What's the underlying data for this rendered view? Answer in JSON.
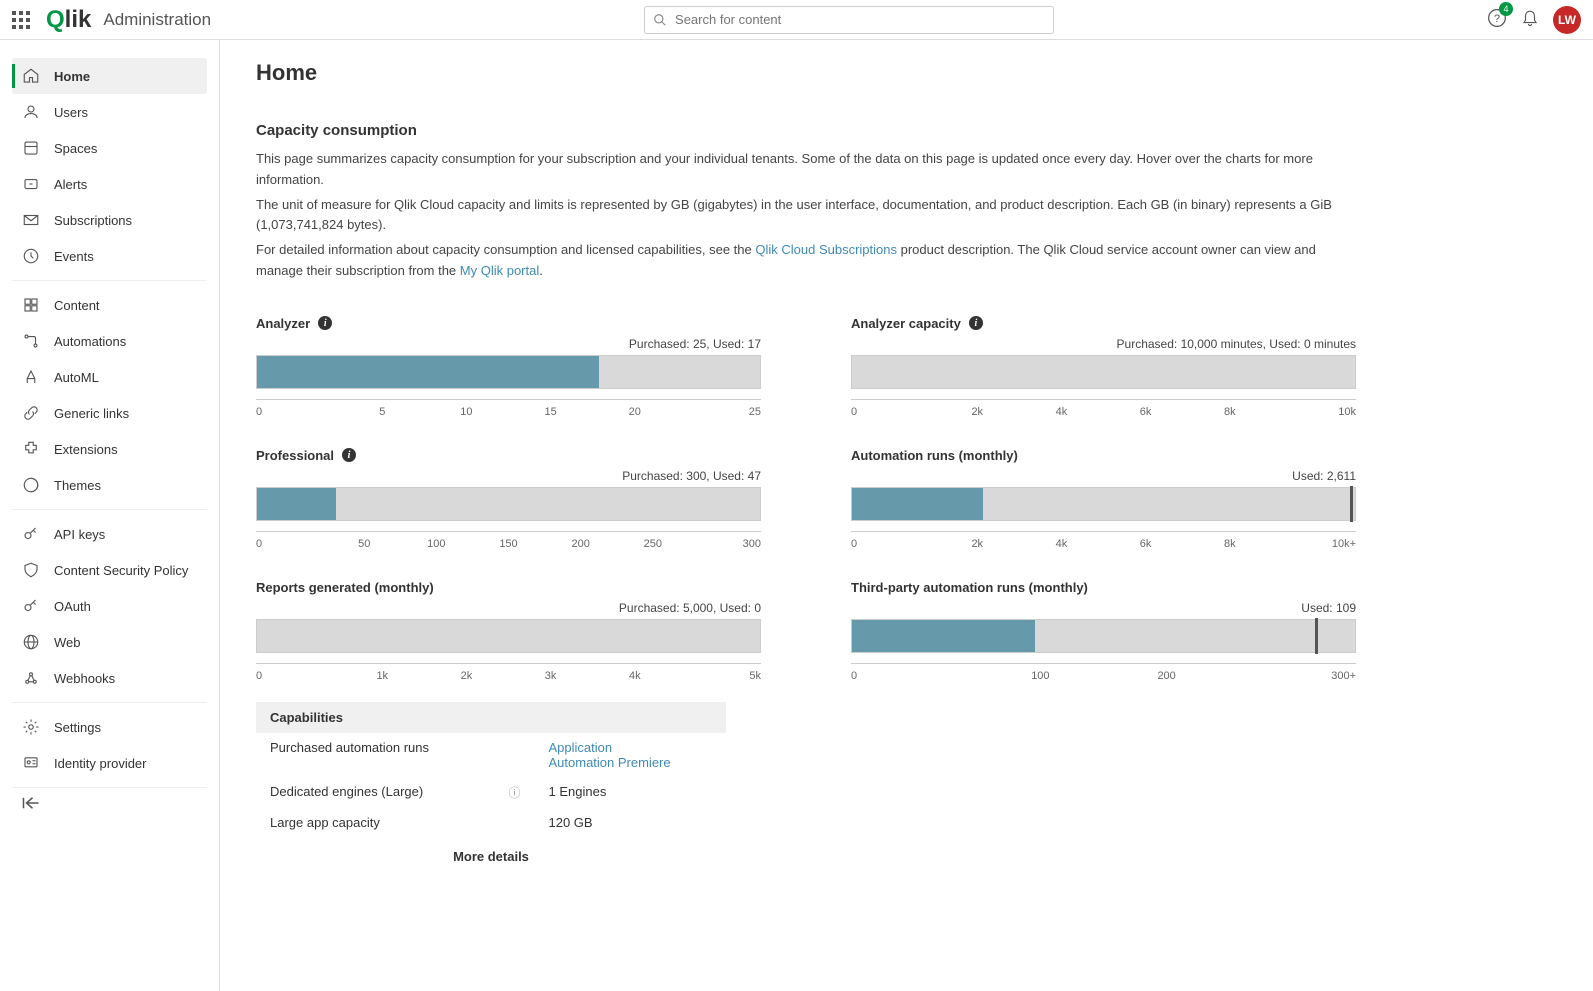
{
  "header": {
    "app_title": "Administration",
    "search_placeholder": "Search for content",
    "help_badge": "4",
    "avatar_initials": "LW"
  },
  "sidebar": {
    "groups": [
      {
        "items": [
          {
            "key": "home",
            "label": "Home",
            "active": true
          },
          {
            "key": "users",
            "label": "Users"
          },
          {
            "key": "spaces",
            "label": "Spaces"
          },
          {
            "key": "alerts",
            "label": "Alerts"
          },
          {
            "key": "subscriptions",
            "label": "Subscriptions"
          },
          {
            "key": "events",
            "label": "Events"
          }
        ]
      },
      {
        "items": [
          {
            "key": "content",
            "label": "Content"
          },
          {
            "key": "automations",
            "label": "Automations"
          },
          {
            "key": "automl",
            "label": "AutoML"
          },
          {
            "key": "generic-links",
            "label": "Generic links"
          },
          {
            "key": "extensions",
            "label": "Extensions"
          },
          {
            "key": "themes",
            "label": "Themes"
          }
        ]
      },
      {
        "items": [
          {
            "key": "api-keys",
            "label": "API keys"
          },
          {
            "key": "csp",
            "label": "Content Security Policy"
          },
          {
            "key": "oauth",
            "label": "OAuth"
          },
          {
            "key": "web",
            "label": "Web"
          },
          {
            "key": "webhooks",
            "label": "Webhooks"
          }
        ]
      },
      {
        "items": [
          {
            "key": "settings",
            "label": "Settings"
          },
          {
            "key": "identity-provider",
            "label": "Identity provider"
          }
        ]
      }
    ]
  },
  "page": {
    "title": "Home",
    "section_title": "Capacity consumption",
    "intro_p1": "This page summarizes capacity consumption for your subscription and your individual tenants. Some of the data on this page is updated once every day. Hover over the charts for more information.",
    "intro_p2": "The unit of measure for Qlik Cloud capacity and limits is represented by GB (gigabytes) in the user interface, documentation, and product description. Each GB (in binary) represents a GiB (1,073,741,824 bytes).",
    "intro_p3_pre": "For detailed information about capacity consumption and licensed capabilities, see the ",
    "intro_p3_link1": "Qlik Cloud Subscriptions",
    "intro_p3_mid": " product description. The Qlik Cloud service account owner can view and manage their subscription from the ",
    "intro_p3_link2": "My Qlik portal",
    "intro_p3_post": "."
  },
  "chart_data": [
    {
      "id": "analyzer",
      "title": "Analyzer",
      "info": true,
      "subtitle": "Purchased: 25, Used: 17",
      "type": "bar",
      "used": 17,
      "max": 25,
      "fill_pct": 68,
      "limit_pct": null,
      "ticks": [
        "0",
        "5",
        "10",
        "15",
        "20",
        "25"
      ]
    },
    {
      "id": "analyzer-capacity",
      "title": "Analyzer capacity",
      "info": true,
      "subtitle": "Purchased: 10,000 minutes, Used: 0 minutes",
      "type": "bar",
      "used": 0,
      "max": 10000,
      "fill_pct": 0,
      "limit_pct": null,
      "ticks": [
        "0",
        "2k",
        "4k",
        "6k",
        "8k",
        "10k"
      ]
    },
    {
      "id": "professional",
      "title": "Professional",
      "info": true,
      "subtitle": "Purchased: 300, Used: 47",
      "type": "bar",
      "used": 47,
      "max": 300,
      "fill_pct": 15.7,
      "limit_pct": null,
      "ticks": [
        "0",
        "50",
        "100",
        "150",
        "200",
        "250",
        "300"
      ]
    },
    {
      "id": "automation-runs",
      "title": "Automation runs (monthly)",
      "info": false,
      "subtitle": "Used: 2,611",
      "type": "bar",
      "used": 2611,
      "max": 10000,
      "fill_pct": 26.1,
      "limit_pct": 99,
      "ticks": [
        "0",
        "2k",
        "4k",
        "6k",
        "8k",
        "10k+"
      ]
    },
    {
      "id": "reports-generated",
      "title": "Reports generated (monthly)",
      "info": false,
      "subtitle": "Purchased: 5,000, Used: 0",
      "type": "bar",
      "used": 0,
      "max": 5000,
      "fill_pct": 0,
      "limit_pct": null,
      "ticks": [
        "0",
        "1k",
        "2k",
        "3k",
        "4k",
        "5k"
      ]
    },
    {
      "id": "third-party-automation",
      "title": "Third-party automation runs (monthly)",
      "info": false,
      "subtitle": "Used: 109",
      "type": "bar",
      "used": 109,
      "max": 300,
      "fill_pct": 36.3,
      "limit_pct": 92,
      "ticks": [
        "0",
        "100",
        "200",
        "300+"
      ]
    }
  ],
  "capabilities": {
    "header": "Capabilities",
    "rows": [
      {
        "label": "Purchased automation runs",
        "info": false,
        "links": [
          "Application",
          "Automation Premiere"
        ],
        "value": ""
      },
      {
        "label": "Dedicated engines (Large)",
        "info": true,
        "links": [],
        "value": "1 Engines"
      },
      {
        "label": "Large app capacity",
        "info": false,
        "links": [],
        "value": "120 GB"
      }
    ],
    "more": "More details"
  }
}
